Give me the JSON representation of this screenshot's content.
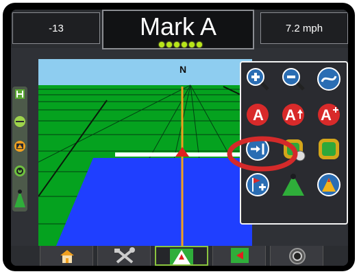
{
  "status": {
    "cross_track": "-13",
    "guidance_line_name": "Mark A",
    "speed": "7.2 mph",
    "led_bar_count": 6
  },
  "map": {
    "compass_label": "N"
  },
  "colors": {
    "sky": "#8ecdf0",
    "field": "#05a21f",
    "coverage": "#1f3fff",
    "guideline": "#f0a020",
    "highlight_ring": "#d42a2a",
    "active_tab_border": "#8bc53f",
    "led_green": "#b8e619"
  },
  "sidebar_icons": [
    "guidance-mode-icon",
    "lightbar-icon",
    "screen-toggle-icon",
    "boundary-icon",
    "vehicle-icon"
  ],
  "guidance_menu": {
    "rows": [
      [
        "zoom-in-icon",
        "zoom-out-icon",
        "curve-line-icon"
      ],
      [
        "mark-a-icon",
        "mark-b-icon",
        "a-plus-nudge-icon"
      ],
      [
        "go-to-point-icon",
        "delete-boundary-icon",
        "boundary-icon"
      ],
      [
        "poi-add-icon",
        "vehicle-view-icon",
        "perspective-view-icon"
      ]
    ],
    "labels": {
      "mark_a": "A",
      "mark_b": "A",
      "a_plus": "A"
    },
    "highlighted_button": "go-to-point-icon"
  },
  "bottom_tabs": [
    "home-tab",
    "tools-tab",
    "guidance-tab",
    "vehicle-tab",
    "camera-tab"
  ],
  "active_tab": "guidance-tab"
}
